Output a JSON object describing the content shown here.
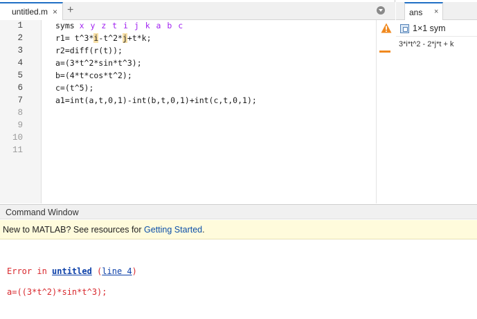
{
  "editor": {
    "tab_label": "untitled.m",
    "tab_close": "×",
    "add_tab": "+",
    "line_numbers": [
      "1",
      "2",
      "3",
      "4",
      "5",
      "6",
      "7",
      "8",
      "9",
      "10",
      "11"
    ],
    "lines": {
      "l1_keyword": "syms ",
      "l1_vars": "x y z t i j k a b c",
      "l2_a": "r1= t^3*",
      "l2_i": "i",
      "l2_b": "-t^2*",
      "l2_j": "j",
      "l2_c": "+t*k;",
      "l3": "r2=diff(r(t));",
      "l4": "a=(3*t^2*sin*t^3);",
      "l5": "b=(4*t*cos*t^2);",
      "l6": "c=(t^5);",
      "l7": "a1=int(a,t,0,1)-int(b,t,0,1)+int(c,t,0,1);"
    }
  },
  "workspace": {
    "tab_label": "ans",
    "tab_close": "×",
    "size": "1×1 sym",
    "value": "3*i*t^2 - 2*j*t + k"
  },
  "command_window": {
    "title": "Command Window",
    "notice_prefix": "New to MATLAB? See resources for ",
    "notice_link": "Getting Started",
    "notice_suffix": ".",
    "error_prefix": "Error in ",
    "error_file": "untitled",
    "error_line": "line 4",
    "error_code": "a=((3*t^2)*sin*t^3);"
  },
  "colors": {
    "accent": "#1f6fc5",
    "keyword_vars": "#a020f0",
    "error_red": "#d8272c",
    "warning_orange": "#f0891f"
  }
}
